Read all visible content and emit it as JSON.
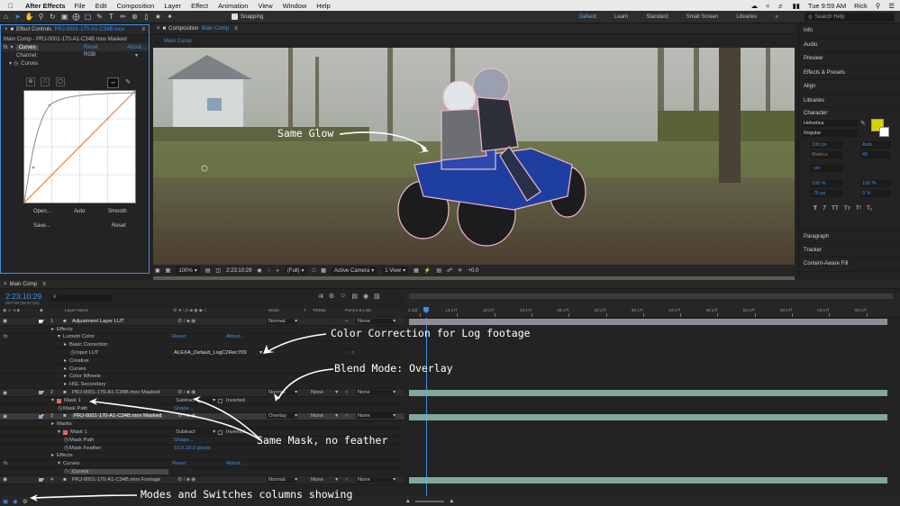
{
  "menubar": {
    "app_name": "After Effects",
    "items": [
      "File",
      "Edit",
      "Composition",
      "Layer",
      "Effect",
      "Animation",
      "View",
      "Window",
      "Help"
    ],
    "time": "Tue 9:59 AM",
    "user": "Rick"
  },
  "toolbar": {
    "snapping_label": "Snapping",
    "workspaces": [
      "Default",
      "Learn",
      "Standard",
      "Small Screen",
      "Libraries"
    ],
    "active_workspace": "Default",
    "search_placeholder": "Search Help"
  },
  "effect_controls": {
    "tab_label": "Effect Controls",
    "tab_file": "PRJ-0001-170-A1-C34B.mov",
    "breadcrumb": "Main Comp - PRJ-0001-170-A1-C34B.mov Masked",
    "effect_name": "Curves",
    "reset_label": "Reset",
    "about_label": "About...",
    "channel_label": "Channel:",
    "channel_value": "RGB",
    "curves_label": "Curves",
    "open_label": "Open...",
    "auto_label": "Auto",
    "smooth_label": "Smooth",
    "save_label": "Save...",
    "reset2_label": "Reset"
  },
  "composition": {
    "tab_label": "Composition",
    "tab_name": "Main Comp",
    "subtab": "Main Comp",
    "zoom": "100%",
    "timecode": "2:23:10:29",
    "resolution": "(Full)",
    "camera": "Active Camera",
    "views": "1 View",
    "exposure": "+0.0"
  },
  "right_panels": {
    "items_top": [
      "Info",
      "Audio",
      "Preview",
      "Effects & Presets",
      "Align",
      "Libraries"
    ],
    "character_title": "Character",
    "font": "Helvetica",
    "style": "Regular",
    "size": "100 px",
    "leading": "Auto",
    "kerning": "Metrics",
    "tracking": "49",
    "stroke": "- px",
    "vscale": "100 %",
    "hscale": "100 %",
    "baseline": "-76 px",
    "tsume": "0 %",
    "items_bottom": [
      "Paragraph",
      "Tracker",
      "Content-Aware Fill"
    ],
    "swatch_color": "#d4d400"
  },
  "timeline": {
    "tab": "Main Comp",
    "timecode": "2:23:10:29",
    "frames": "257739 (29.97 fps)",
    "col_layer_name": "Layer Name",
    "col_mode": "Mode",
    "col_t": "T",
    "col_trkmat": "TrkMat",
    "col_parent": "Parent & Link",
    "ruler": [
      "2:13f",
      "13:17f",
      "18:17f",
      "23:17f",
      "28:17f",
      "33:17f",
      "38:17f",
      "43:17f",
      "48:17f",
      "53:17f",
      "58:17f",
      "03:17f",
      "08:17f"
    ],
    "rows": [
      {
        "num": "1",
        "name": "Adjustment Layer LUT",
        "mode": "Normal",
        "trkmat": "",
        "parent": "None",
        "indent": 0,
        "kind": "layer"
      },
      {
        "name": "Effects",
        "indent": 1,
        "kind": "group"
      },
      {
        "name": "Lumetri Color",
        "indent": 2,
        "kind": "fx",
        "reset": "Reset",
        "about": "About..."
      },
      {
        "name": "Basic Correction",
        "indent": 3,
        "kind": "group"
      },
      {
        "name": "Input LUT",
        "indent": 4,
        "kind": "prop",
        "value": "ALEXA_Default_LogC2Rec709"
      },
      {
        "name": "Creative",
        "indent": 3,
        "kind": "group"
      },
      {
        "name": "Curves",
        "indent": 3,
        "kind": "group"
      },
      {
        "name": "Color Wheels",
        "indent": 3,
        "kind": "group"
      },
      {
        "name": "HSL Secondary",
        "indent": 3,
        "kind": "group"
      },
      {
        "num": "2",
        "name": "PRJ-0001-170-A1-C34B.mov Masked",
        "mode": "Normal",
        "trkmat": "None",
        "parent": "None",
        "indent": 0,
        "kind": "layer"
      },
      {
        "name": "Mask 1",
        "indent": 1,
        "kind": "mask",
        "mode": "Subtract",
        "inverted": "Inverted"
      },
      {
        "name": "Mask Path",
        "indent": 2,
        "kind": "prop",
        "value": "Shape..."
      },
      {
        "num": "3",
        "name": "PRJ-0001-170-A1-C34B.mov Masked",
        "mode": "Overlay",
        "trkmat": "None",
        "parent": "None",
        "indent": 0,
        "kind": "layer",
        "selected": true
      },
      {
        "name": "Masks",
        "indent": 1,
        "kind": "group"
      },
      {
        "name": "Mask 1",
        "indent": 2,
        "kind": "mask",
        "mode": "Subtract",
        "inverted": "Inverted"
      },
      {
        "name": "Mask Path",
        "indent": 3,
        "kind": "prop",
        "value": "Shape..."
      },
      {
        "name": "Mask Feather",
        "indent": 3,
        "kind": "prop",
        "value": "10.0,10.0 pixels"
      },
      {
        "name": "Effects",
        "indent": 1,
        "kind": "group"
      },
      {
        "name": "Curves",
        "indent": 2,
        "kind": "fx",
        "reset": "Reset",
        "about": "About..."
      },
      {
        "name": "Curves",
        "indent": 3,
        "kind": "prop",
        "value": ""
      },
      {
        "num": "4",
        "name": "PRJ-0001-170-A1-C34B.mov Footage",
        "mode": "Normal",
        "trkmat": "None",
        "parent": "None",
        "indent": 0,
        "kind": "layer"
      }
    ]
  },
  "annotations": {
    "glow": "Same Glow",
    "color_correction": "Color Correction for Log footage",
    "blend_mode": "Blend Mode: Overlay",
    "same_mask": "Same Mask, no feather",
    "modes_switches": "Modes and Switches columns showing"
  }
}
